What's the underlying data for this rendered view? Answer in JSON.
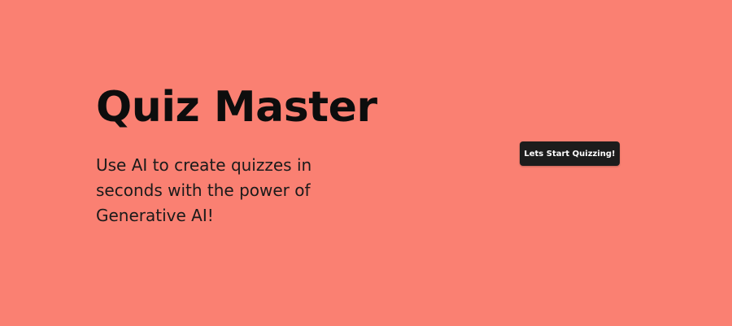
{
  "hero": {
    "title": "Quiz Master",
    "subtitle": "Use AI to create quizzes in seconds with the power of Generative AI!"
  },
  "cta": {
    "label": "Lets Start Quizzing!"
  },
  "colors": {
    "background": "#FA8072",
    "button_bg": "#1C1C1C",
    "button_text": "#FFFFFF",
    "text": "#0D0D0D"
  }
}
